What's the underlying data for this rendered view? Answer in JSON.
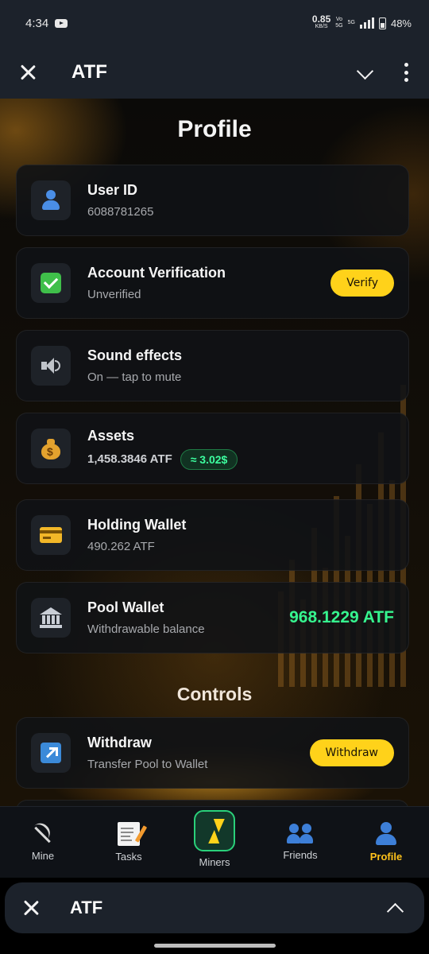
{
  "status_bar": {
    "time": "4:34",
    "net_speed_value": "0.85",
    "net_speed_unit": "KB/S",
    "volte_top": "Vo",
    "volte_bottom": "5G",
    "network": "5G",
    "battery": "48%"
  },
  "app_bar": {
    "title": "ATF"
  },
  "page": {
    "title": "Profile",
    "controls_title": "Controls"
  },
  "cards": {
    "user_id": {
      "label": "User ID",
      "value": "6088781265",
      "icon": "user-icon"
    },
    "verification": {
      "label": "Account Verification",
      "value": "Unverified",
      "button": "Verify",
      "icon": "check-mark-icon"
    },
    "sound": {
      "label": "Sound effects",
      "value": "On — tap to mute",
      "icon": "speaker-icon"
    },
    "assets": {
      "label": "Assets",
      "value": "1,458.3846 ATF",
      "usd": "≈ 3.02$",
      "icon": "money-bag-icon"
    },
    "holding": {
      "label": "Holding Wallet",
      "value": "490.262 ATF",
      "icon": "credit-card-icon"
    },
    "pool": {
      "label": "Pool Wallet",
      "value": "Withdrawable balance",
      "amount": "968.1229 ATF",
      "icon": "bank-icon"
    },
    "withdraw": {
      "label": "Withdraw",
      "value": "Transfer Pool to Wallet",
      "button": "Withdraw",
      "icon": "up-right-arrow-icon"
    }
  },
  "bottom_nav": {
    "items": [
      {
        "label": "Mine",
        "icon": "pickaxe-icon"
      },
      {
        "label": "Tasks",
        "icon": "memo-icon"
      },
      {
        "label": "Miners",
        "icon": "lightning-icon"
      },
      {
        "label": "Friends",
        "icon": "friends-icon"
      },
      {
        "label": "Profile",
        "icon": "profile-icon",
        "active": true
      }
    ]
  },
  "sheet_bar": {
    "title": "ATF"
  },
  "colors": {
    "accent_yellow": "#ffd21a",
    "accent_green": "#36f58f",
    "active_nav": "#ffc21a",
    "bar_bg": "#1c222b"
  }
}
